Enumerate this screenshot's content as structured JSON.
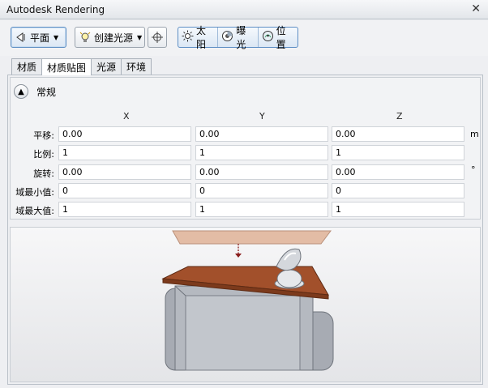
{
  "window": {
    "title": "Autodesk Rendering",
    "close_glyph": "✕"
  },
  "toolbar": {
    "plane_label": "平面",
    "plane_icon": "plane-light-icon",
    "create_light_label": "创建光源",
    "create_light_icon": "create-light-icon",
    "target_icon": "crosshair-icon",
    "sun_label": "太阳",
    "sun_icon": "sun-icon",
    "exposure_label": "曝光",
    "exposure_icon": "exposure-icon",
    "location_label": "位置",
    "location_icon": "location-icon"
  },
  "tabs": [
    {
      "label": "材质",
      "active": false
    },
    {
      "label": "材质贴图",
      "active": true
    },
    {
      "label": "光源",
      "active": false
    },
    {
      "label": "环境",
      "active": false
    }
  ],
  "section": {
    "title": "常规",
    "columns": [
      "X",
      "Y",
      "Z"
    ],
    "rows": [
      {
        "label": "平移:",
        "values": [
          "0.00",
          "0.00",
          "0.00"
        ],
        "unit": "m"
      },
      {
        "label": "比例:",
        "values": [
          "1",
          "1",
          "1"
        ],
        "unit": ""
      },
      {
        "label": "旋转:",
        "values": [
          "0.00",
          "0.00",
          "0.00"
        ],
        "unit": "°"
      },
      {
        "label": "域最小值:",
        "values": [
          "0",
          "0",
          "0"
        ],
        "unit": ""
      },
      {
        "label": "域最大值:",
        "values": [
          "1",
          "1",
          "1"
        ],
        "unit": ""
      }
    ]
  },
  "colors": {
    "accent": "#5d8ec4",
    "wood": "#a2502b",
    "plane": "#e0b9a3"
  }
}
